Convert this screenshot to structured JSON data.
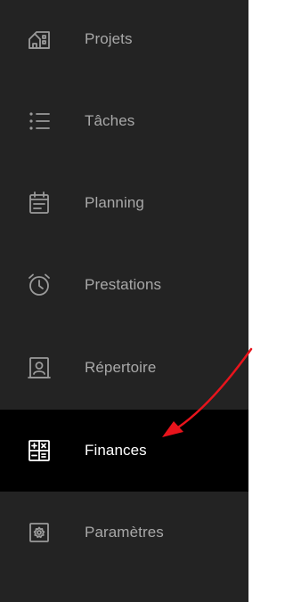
{
  "sidebar": {
    "items": [
      {
        "label": "Projets",
        "icon": "building-icon",
        "active": false
      },
      {
        "label": "Tâches",
        "icon": "task-list-icon",
        "active": false
      },
      {
        "label": "Planning",
        "icon": "calendar-icon",
        "active": false
      },
      {
        "label": "Prestations",
        "icon": "alarm-clock-icon",
        "active": false
      },
      {
        "label": "Répertoire",
        "icon": "contact-card-icon",
        "active": false
      },
      {
        "label": "Finances",
        "icon": "calculator-icon",
        "active": true
      },
      {
        "label": "Paramètres",
        "icon": "settings-icon",
        "active": false
      }
    ]
  },
  "colors": {
    "sidebar_bg": "#232323",
    "active_bg": "#000000",
    "label": "#a8a8a8",
    "active_label": "#ffffff",
    "annotation_arrow": "#e8141c"
  }
}
